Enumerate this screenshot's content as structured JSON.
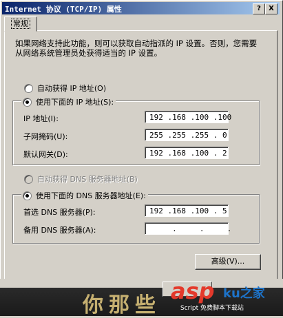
{
  "window": {
    "title": "Internet 协议 (TCP/IP) 属性",
    "help_label": "?",
    "close_label": "X"
  },
  "tab": {
    "label": "常规"
  },
  "description": "如果网络支持此功能，则可以获取自动指派的 IP 设置。否则，您需要从网络系统管理员处获得适当的 IP 设置。",
  "ip": {
    "auto_label": "自动获得 IP 地址(O)",
    "manual_label": "使用下面的 IP 地址(S):",
    "ip_label": "IP 地址(I):",
    "ip_value": "192 .168 .100 .100",
    "mask_label": "子网掩码(U):",
    "mask_value": "255 .255 .255 . 0",
    "gateway_label": "默认网关(D):",
    "gateway_value": "192 .168 .100 . 2"
  },
  "dns": {
    "auto_label": "自动获得 DNS 服务器地址(B)",
    "manual_label": "使用下面的 DNS 服务器地址(E):",
    "preferred_label": "首选 DNS 服务器(P):",
    "preferred_value": "192 .168 .100 . 5",
    "alternate_label": "备用 DNS 服务器(A):",
    "alternate_value": "     .     .     ."
  },
  "advanced_button": "高级(V)...",
  "watermark": {
    "zh_text": "你那些",
    "asp_text": "asp",
    "site_text": "ku之家",
    "sub_text": "Script 免费脚本下载站"
  }
}
